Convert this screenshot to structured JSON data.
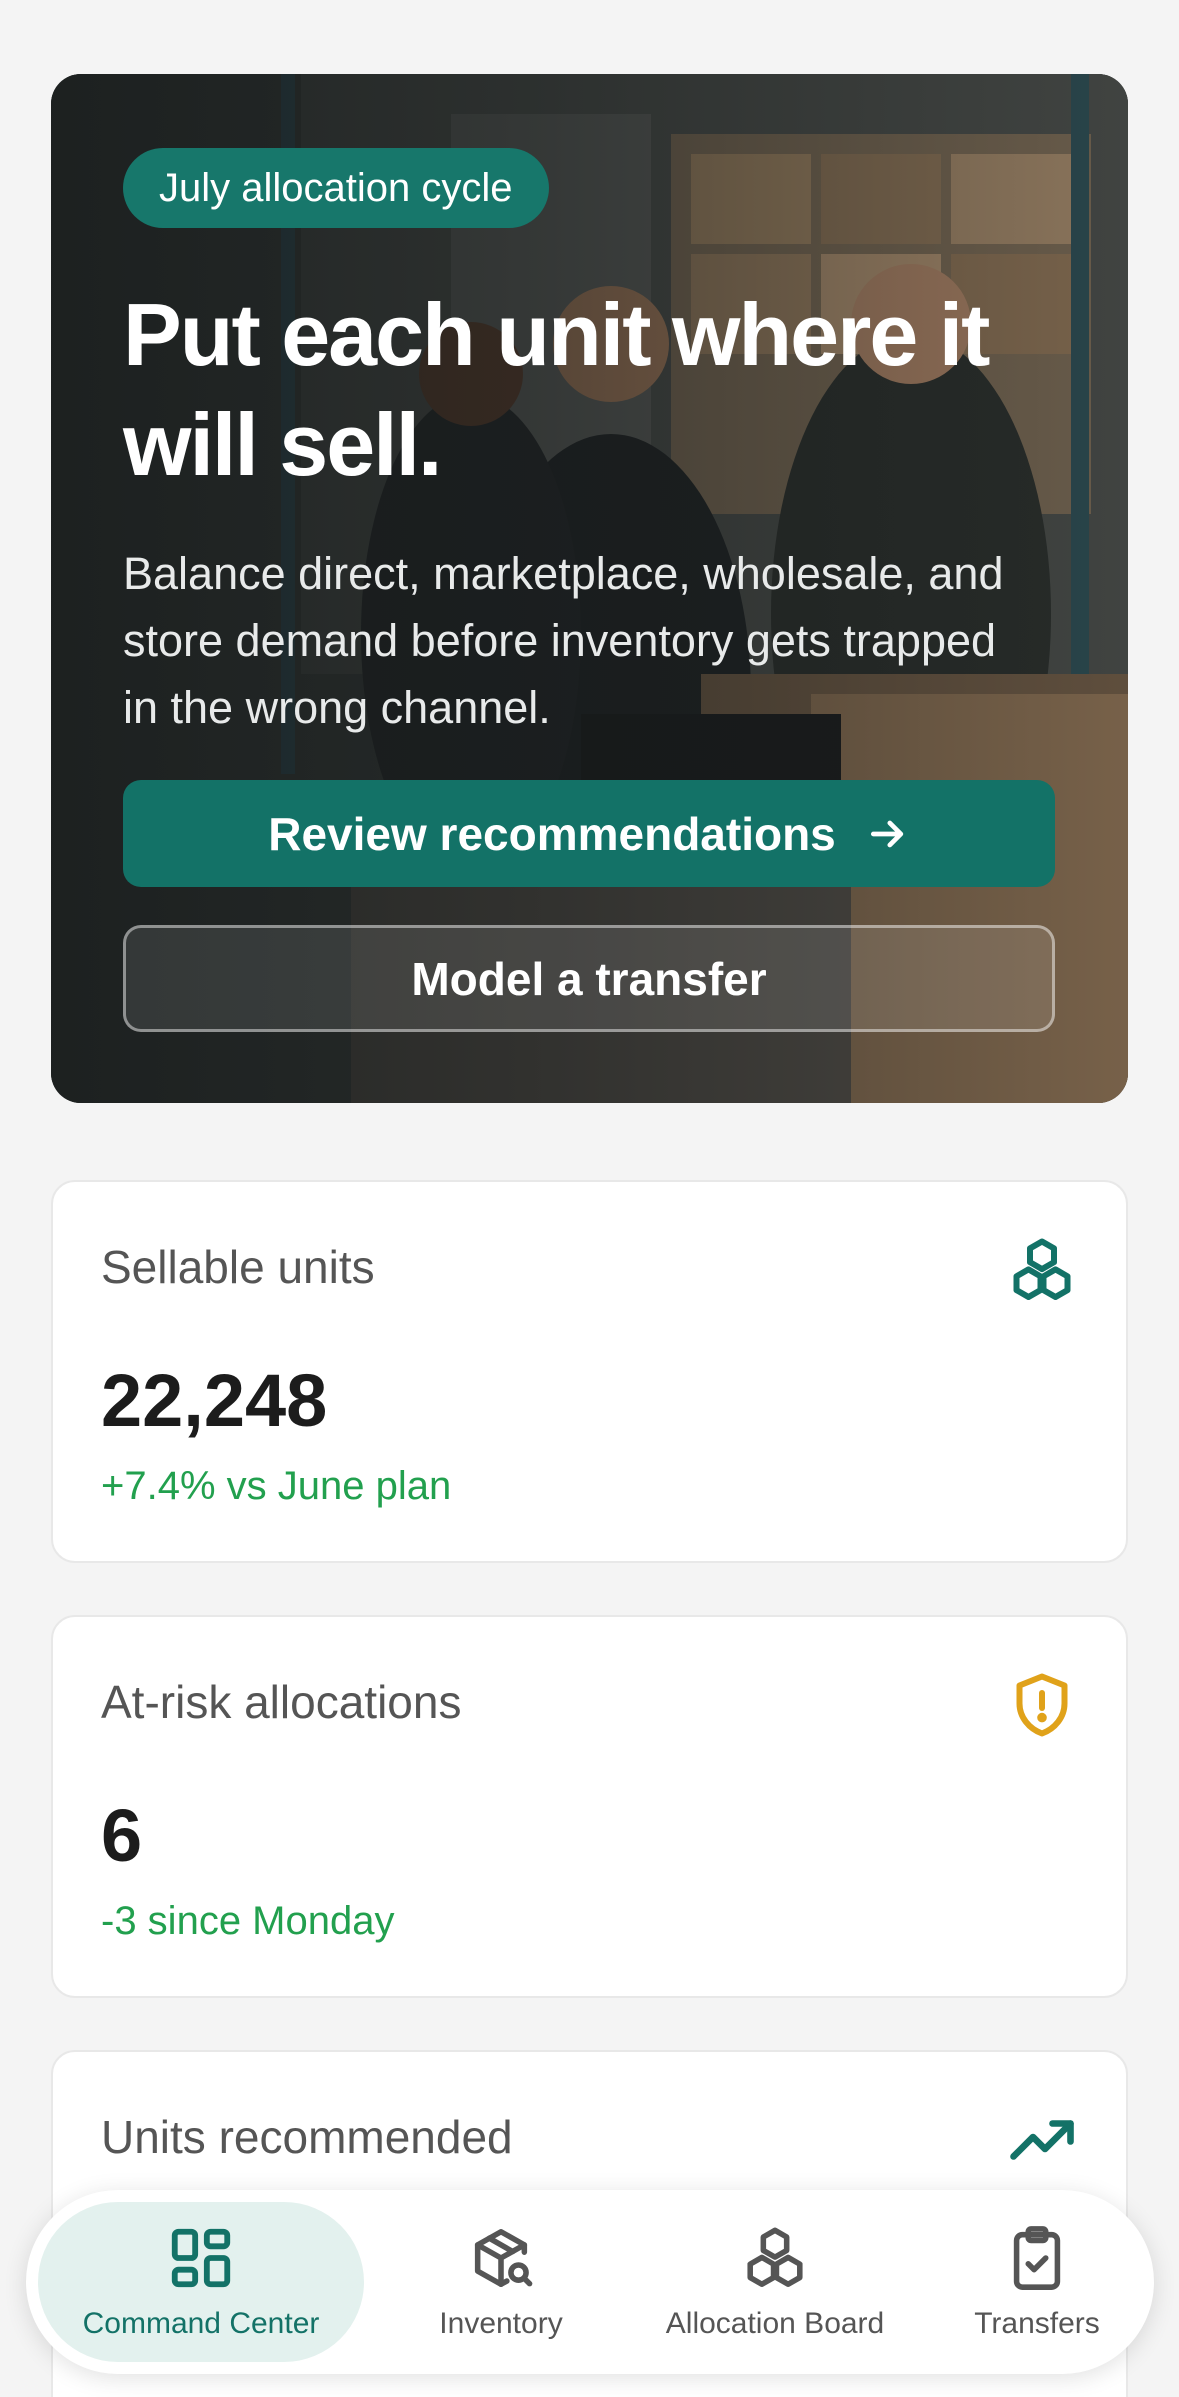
{
  "hero": {
    "tag": "July allocation cycle",
    "title": "Put each unit where it will sell.",
    "subtitle": "Balance direct, marketplace, wholesale, and store demand before inventory gets trapped in the wrong channel.",
    "primary_button": "Review recommendations",
    "secondary_button": "Model a transfer"
  },
  "metrics": [
    {
      "label": "Sellable units",
      "value": "22,248",
      "delta": "+7.4% vs June plan",
      "icon": "cubes-icon"
    },
    {
      "label": "At-risk allocations",
      "value": "6",
      "delta": "-3 since Monday",
      "icon": "shield-alert-icon"
    },
    {
      "label": "Units recommended",
      "icon": "trending-up-icon"
    }
  ],
  "nav": {
    "items": [
      {
        "label": "Command Center",
        "icon": "grid-icon",
        "active": true
      },
      {
        "label": "Inventory",
        "icon": "package-search-icon",
        "active": false
      },
      {
        "label": "Allocation Board",
        "icon": "boxes-icon",
        "active": false
      },
      {
        "label": "Transfers",
        "icon": "clipboard-check-icon",
        "active": false
      }
    ]
  },
  "colors": {
    "accent": "#137267",
    "positive": "#22a04e",
    "warning": "#e0a21a",
    "nav_active_bg": "#e3f1ee"
  }
}
